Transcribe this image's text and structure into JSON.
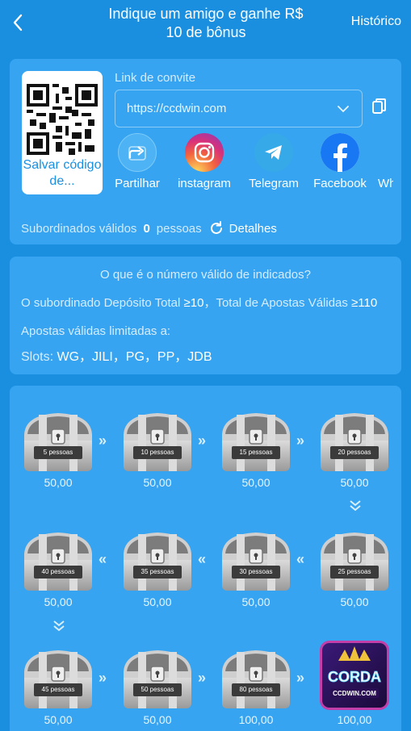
{
  "header": {
    "title_line1": "Indique um amigo e ganhe R$",
    "title_line2": "10 de bônus",
    "history": "Histórico"
  },
  "invite": {
    "qr_label": "Salvar código de...",
    "link_label": "Link de convite",
    "link_value": "https://ccdwin.com",
    "share": [
      {
        "label": "Partilhar",
        "icon": "share-icon"
      },
      {
        "label": "instagram",
        "icon": "instagram-icon"
      },
      {
        "label": "Telegram",
        "icon": "telegram-icon"
      },
      {
        "label": "Facebook",
        "icon": "facebook-icon"
      },
      {
        "label": "Wha",
        "icon": "whatsapp-icon"
      }
    ],
    "subordinates_label": "Subordinados válidos",
    "subordinates_count": "0",
    "subordinates_unit": "pessoas",
    "details": "Detalhes"
  },
  "info": {
    "title": "O que é o número válido de indicados?",
    "line1_prefix": "O subordinado Depósito Total ",
    "line1_v1": "≥10",
    "line1_mid": "，Total de Apostas Válidas ",
    "line1_v2": "≥110",
    "line2": "Apostas válidas limitadas a:",
    "slots_label": "Slots: ",
    "slots_value": "WG，JILI，PG，PP，JDB"
  },
  "chests": [
    {
      "label": "5 pessoas",
      "amount": "50,00"
    },
    {
      "label": "10 pessoas",
      "amount": "50,00"
    },
    {
      "label": "15 pessoas",
      "amount": "50,00"
    },
    {
      "label": "20 pessoas",
      "amount": "50,00"
    },
    {
      "label": "40 pessoas",
      "amount": "50,00"
    },
    {
      "label": "35 pessoas",
      "amount": "50,00"
    },
    {
      "label": "30 pessoas",
      "amount": "50,00"
    },
    {
      "label": "25 pessoas",
      "amount": "50,00"
    },
    {
      "label": "45 pessoas",
      "amount": "50,00"
    },
    {
      "label": "50 pessoas",
      "amount": "50,00"
    },
    {
      "label": "80 pessoas",
      "amount": "100,00"
    },
    {
      "label": "CCDWIN.COM",
      "amount": "100,00"
    }
  ],
  "badge": {
    "title": "CORDA",
    "subtitle": "CCDWIN.COM"
  },
  "colors": {
    "bg": "#1a8fe0",
    "card": "#36a4f0"
  }
}
